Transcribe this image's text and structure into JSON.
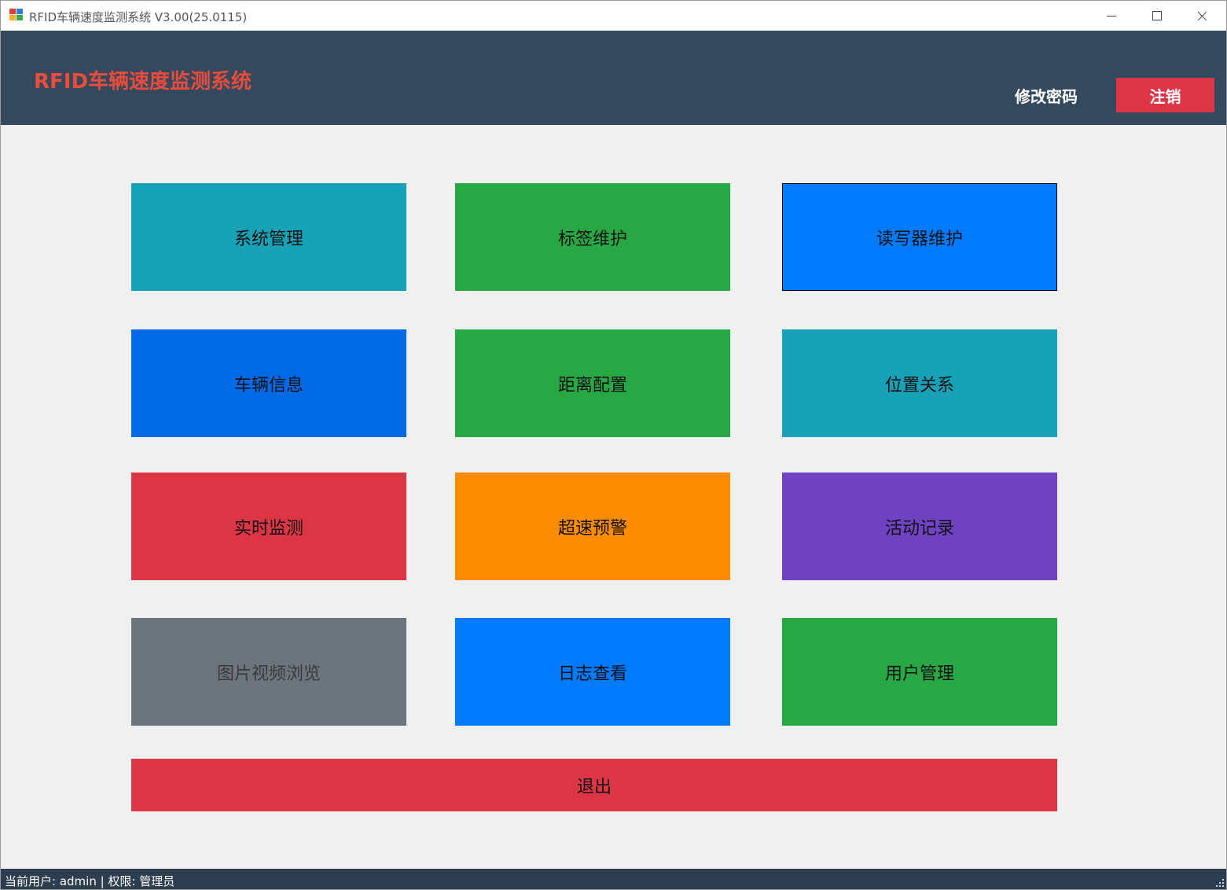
{
  "window": {
    "title": "RFID车辆速度监测系统 V3.00(25.0115)",
    "controls": [
      "minimize",
      "maximize",
      "close"
    ]
  },
  "header": {
    "brand": "RFID车辆速度监测系统",
    "change_password_label": "修改密码",
    "logout_label": "注销",
    "colors": {
      "background": "#34495e",
      "brand": "#e74c3c",
      "logout": "#dc3545"
    }
  },
  "tiles": [
    {
      "label": "系统管理",
      "color": "#17a2b8"
    },
    {
      "label": "标签维护",
      "color": "#28a745"
    },
    {
      "label": "读写器维护",
      "color": "#007bff"
    },
    {
      "label": "车辆信息",
      "color": "#0069e6"
    },
    {
      "label": "距离配置",
      "color": "#28a745"
    },
    {
      "label": "位置关系",
      "color": "#17a2b8"
    },
    {
      "label": "实时监测",
      "color": "#dc3545"
    },
    {
      "label": "超速预警",
      "color": "#fd8c00"
    },
    {
      "label": "活动记录",
      "color": "#6f42c1"
    },
    {
      "label": "图片视频浏览",
      "color": "#6c757d"
    },
    {
      "label": "日志查看",
      "color": "#007bff"
    },
    {
      "label": "用户管理",
      "color": "#28a745"
    }
  ],
  "exit": {
    "label": "退出",
    "color": "#dc3545"
  },
  "status": {
    "text": "当前用户: admin | 权限: 管理员"
  }
}
